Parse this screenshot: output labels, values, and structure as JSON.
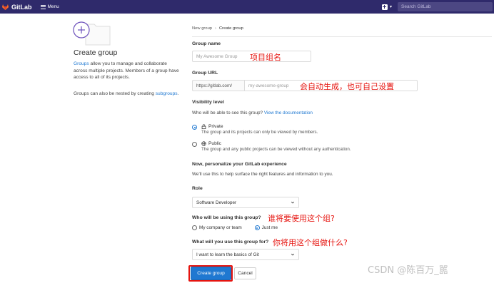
{
  "navbar": {
    "brand": "GitLab",
    "menu_label": "Menu",
    "search_placeholder": "Search GitLab",
    "bg_color": "#2f2a6b"
  },
  "left": {
    "title": "Create group",
    "desc_link": "Groups",
    "desc_rest": " allow you to manage and collaborate across multiple projects. Members of a group have access to all of its projects.",
    "nest_text": "Groups can also be nested by creating ",
    "nest_link": "subgroups",
    "nest_end": "."
  },
  "breadcrumb": {
    "parent": "New group",
    "current": "Create group"
  },
  "form": {
    "group_name_label": "Group name",
    "group_name_placeholder": "My Awesome Group",
    "group_url_label": "Group URL",
    "group_url_prefix": "https://gitlab.com/",
    "group_url_placeholder": "my-awesome-group",
    "visibility_label": "Visibility level",
    "visibility_help": "Who will be able to see this group? ",
    "visibility_help_link": "View the documentation",
    "private_title": "Private",
    "private_desc": "The group and its projects can only be viewed by members.",
    "public_title": "Public",
    "public_desc": "The group and any public projects can be viewed without any authentication.",
    "personalize_label": "Now, personalize your GitLab experience",
    "personalize_help": "We'll use this to help surface the right features and information to you.",
    "role_label": "Role",
    "role_value": "Software Developer",
    "who_label": "Who will be using this group?",
    "who_option_company": "My company or team",
    "who_option_me": "Just me",
    "what_label": "What will you use this group for?",
    "what_value": "I want to learn the basics of Git",
    "create_button": "Create group",
    "cancel_button": "Cancel"
  },
  "annotations": {
    "group_name": "项目组名",
    "group_url": "会自动生成，也可自己设置",
    "who": "谁将要使用这个组?",
    "what": "你将用这个组做什么?"
  },
  "watermark": "CSDN @陈百万_嚚"
}
